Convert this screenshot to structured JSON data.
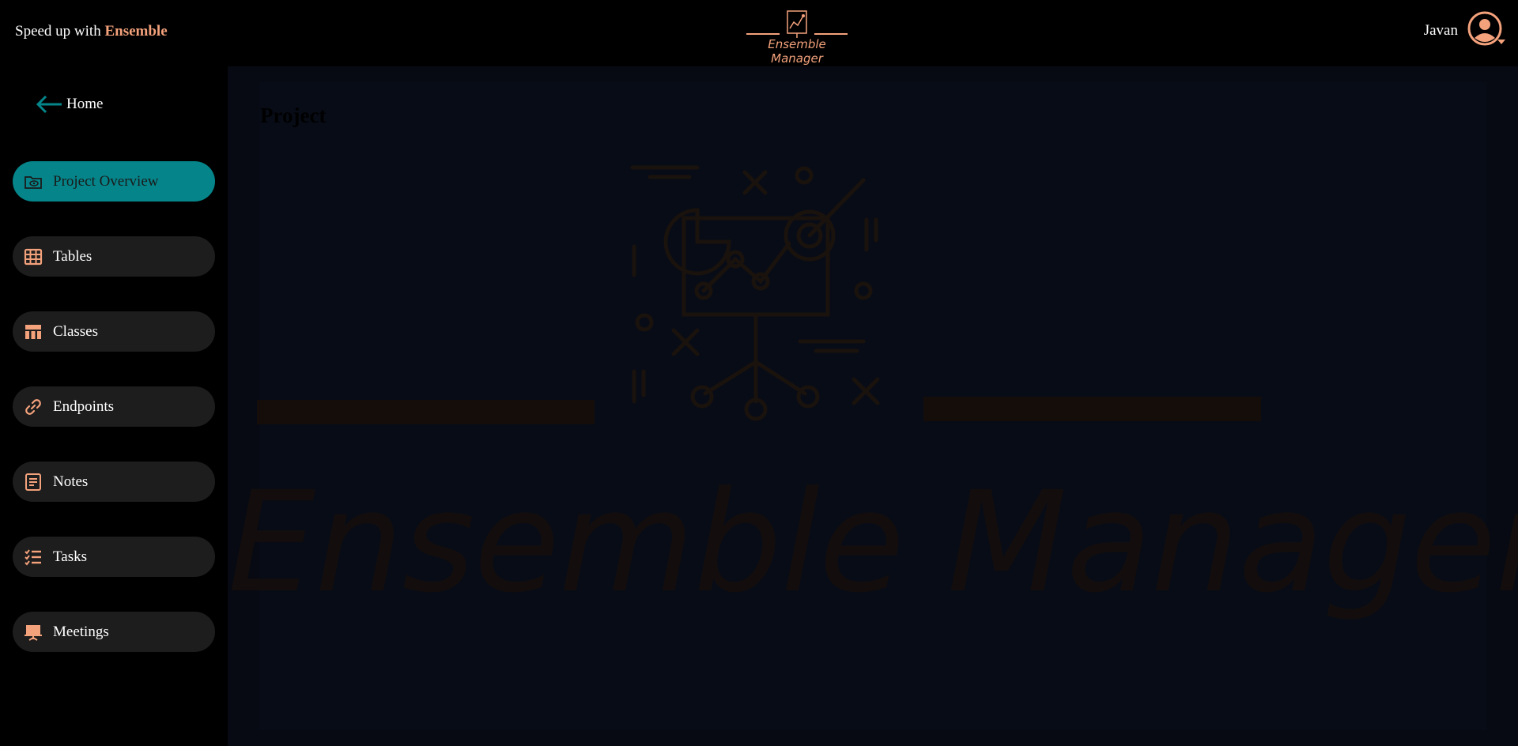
{
  "header": {
    "tagline_prefix": "Speed up with",
    "tagline_brand": "Ensemble",
    "logo_text": "Ensemble Manager",
    "user_name": "Javan",
    "accent_color": "#f4a27c"
  },
  "sidebar": {
    "home_label": "Home",
    "items": [
      {
        "label": "Project Overview",
        "icon": "folder-eye-icon",
        "active": true
      },
      {
        "label": "Tables",
        "icon": "table-grid-icon",
        "active": false
      },
      {
        "label": "Classes",
        "icon": "class-table-icon",
        "active": false
      },
      {
        "label": "Endpoints",
        "icon": "link-icon",
        "active": false
      },
      {
        "label": "Notes",
        "icon": "notes-icon",
        "active": false
      },
      {
        "label": "Tasks",
        "icon": "checklist-icon",
        "active": false
      },
      {
        "label": "Meetings",
        "icon": "presentation-icon",
        "active": false
      }
    ],
    "active_color": "#05858a"
  },
  "main": {
    "page_title": "Project",
    "watermark_text": "Ensemble Manager",
    "hero_icon": "presentation-chart-icon"
  }
}
